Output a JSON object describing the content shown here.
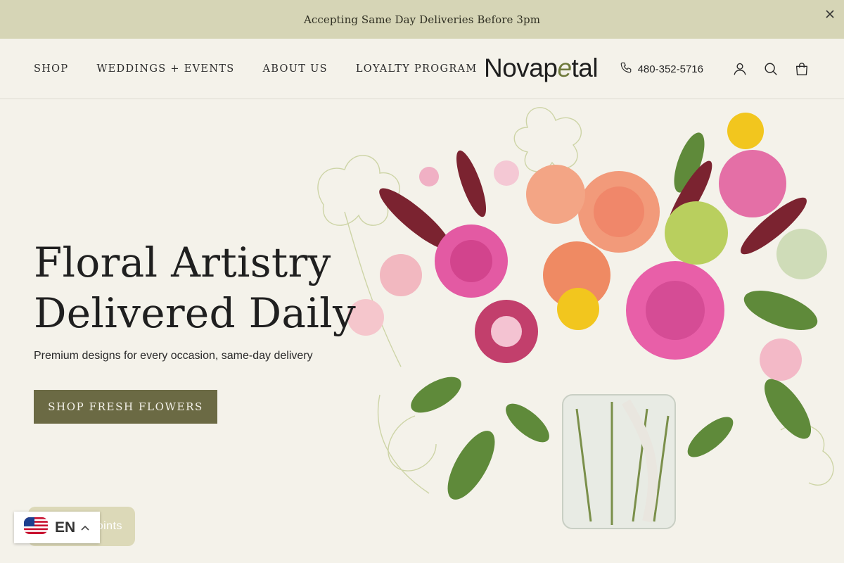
{
  "announcement": {
    "text": "Accepting Same Day Deliveries Before 3pm"
  },
  "header": {
    "nav": [
      "SHOP",
      "WEDDINGS + EVENTS",
      "ABOUT US",
      "LOYALTY PROGRAM"
    ],
    "logo_main": "Novap",
    "logo_accent": "e",
    "logo_end": "tal",
    "phone": "480-352-5716",
    "icons": [
      "phone-icon",
      "account-icon",
      "search-icon",
      "bag-icon"
    ]
  },
  "hero": {
    "title_line1": "Floral Artistry",
    "title_line2": "Delivered Daily",
    "subtitle": "Premium designs for every occasion, same-day delivery",
    "cta": "SHOP FRESH FLOWERS"
  },
  "rewards": {
    "label": "oints"
  },
  "language": {
    "code": "EN",
    "flag": "us-flag-icon"
  },
  "colors": {
    "announce_bg": "#d6d5b6",
    "page_bg": "#f4f2ea",
    "cta_bg": "#6b6a44",
    "accent": "#6f7a3c"
  }
}
